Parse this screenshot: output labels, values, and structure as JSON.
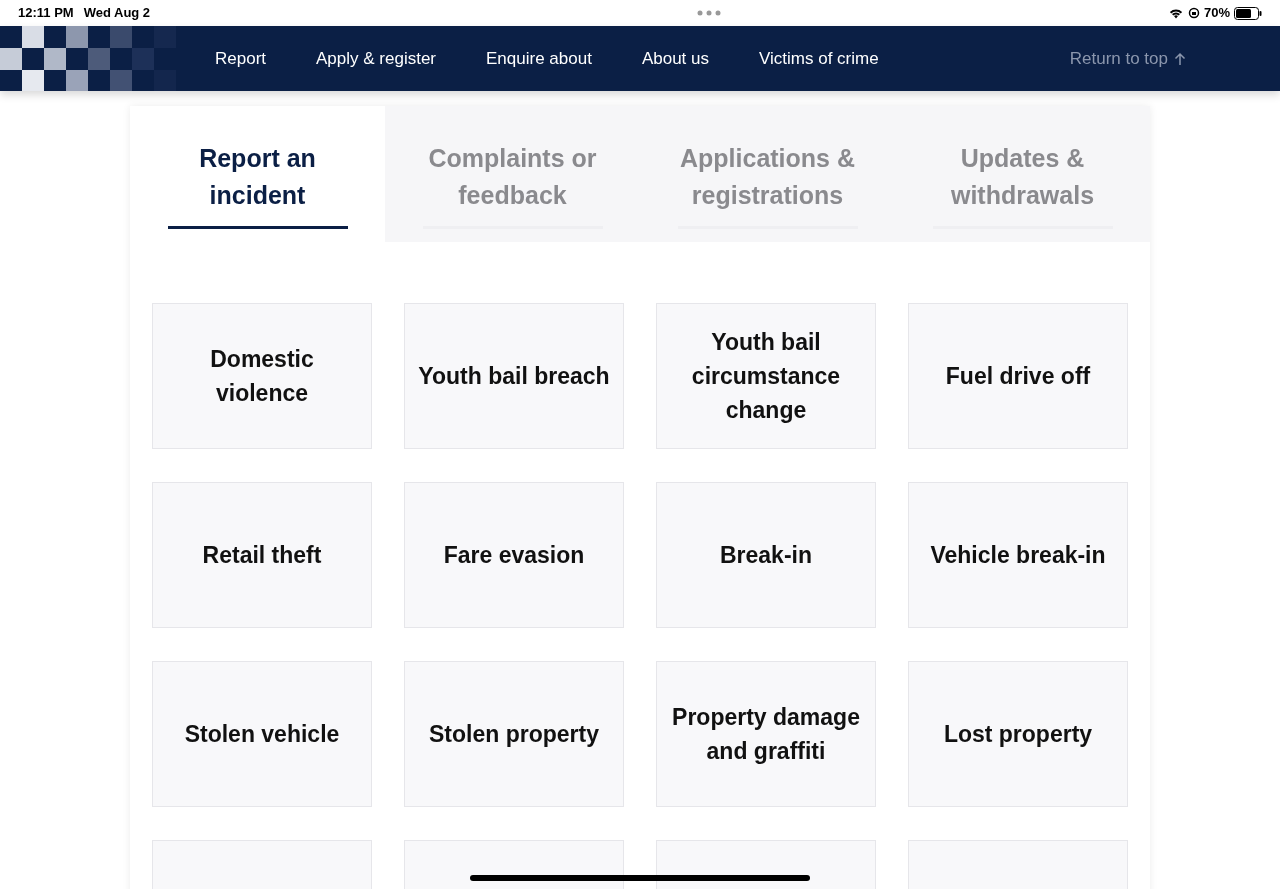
{
  "status_bar": {
    "time": "12:11 PM",
    "date": "Wed Aug 2",
    "battery": "70%"
  },
  "nav": {
    "items": [
      "Report",
      "Apply & register",
      "Enquire about",
      "About us",
      "Victims of crime"
    ],
    "return_link": "Return to top"
  },
  "tabs": [
    {
      "label": "Report an incident",
      "selected": true
    },
    {
      "label": "Complaints or feedback",
      "selected": false
    },
    {
      "label": "Applications & registrations",
      "selected": false
    },
    {
      "label": "Updates & withdrawals",
      "selected": false
    }
  ],
  "tiles": [
    {
      "kind": "label",
      "label": "Domestic violence"
    },
    {
      "kind": "label",
      "label": "Youth bail breach"
    },
    {
      "kind": "label",
      "label": "Youth bail circumstance change"
    },
    {
      "kind": "label",
      "label": "Fuel drive off"
    },
    {
      "kind": "label",
      "label": "Retail theft"
    },
    {
      "kind": "label",
      "label": "Fare evasion"
    },
    {
      "kind": "label",
      "label": "Break-in"
    },
    {
      "kind": "label",
      "label": "Vehicle break-in"
    },
    {
      "kind": "label",
      "label": "Stolen vehicle"
    },
    {
      "kind": "label",
      "label": "Stolen property"
    },
    {
      "kind": "label",
      "label": "Property damage and graffiti"
    },
    {
      "kind": "label",
      "label": "Lost property"
    },
    {
      "kind": "cut"
    },
    {
      "kind": "cut"
    },
    {
      "kind": "cut"
    },
    {
      "kind": "cut"
    }
  ]
}
